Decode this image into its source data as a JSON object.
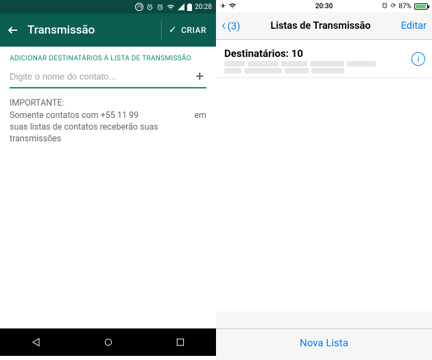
{
  "left": {
    "status": {
      "badge": "79",
      "time": "20:28"
    },
    "appbar": {
      "title": "Transmissão",
      "action": "CRIAR"
    },
    "section_label": "ADICIONAR DESTINATÁRIOS À LISTA DE TRANSMISSÃO",
    "input": {
      "placeholder": "Digite o nome do contato..."
    },
    "notice": {
      "heading": "IMPORTANTE:",
      "line1a": "Somente contatos com +55 11 99",
      "line1b": "em",
      "line2": "suas listas de contatos receberão suas",
      "line3": "transmissões"
    }
  },
  "right": {
    "status": {
      "time": "20:30",
      "battery_pct": "87%"
    },
    "nav": {
      "back_count": "(3)",
      "title": "Listas de Transmissão",
      "edit": "Editar"
    },
    "recipients": {
      "label": "Destinatários: 10"
    },
    "toolbar": {
      "new_list": "Nova Lista"
    }
  }
}
